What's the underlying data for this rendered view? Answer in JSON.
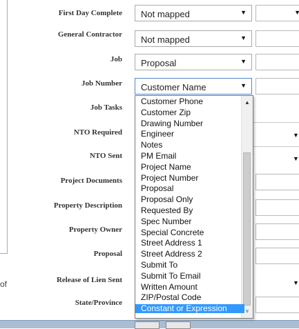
{
  "fields": [
    {
      "label": "First Day Complete",
      "value": "Not mapped"
    },
    {
      "label": "General Contractor",
      "value": "Not mapped"
    },
    {
      "label": "Job",
      "value": "Proposal"
    },
    {
      "label": "Job Number",
      "value": "Customer Name"
    },
    {
      "label": "Job Tasks"
    },
    {
      "label": "NTO Required"
    },
    {
      "label": "NTO Sent"
    },
    {
      "label": "Project Documents"
    },
    {
      "label": "Property Description"
    },
    {
      "label": "Property Owner"
    },
    {
      "label": "Proposal"
    },
    {
      "label": "Release of Lien Sent"
    },
    {
      "label": "State/Province"
    }
  ],
  "dropdown": {
    "options": [
      "Customer Phone",
      "Customer Zip",
      "Drawing Number",
      "Engineer",
      "Notes",
      "PM Email",
      "Project Name",
      "Project Number",
      "Proposal",
      "Proposal Only",
      "Requested By",
      "Spec Number",
      "Special Concrete",
      "Street Address 1",
      "Street Address 2",
      "Submit To",
      "Submit To Email",
      "Written Amount",
      "ZIP/Postal Code",
      "Constant or Expression"
    ],
    "selected_index": 19
  },
  "left_fragment": "of",
  "icons": {
    "dropdown_arrow": "▼",
    "scroll_up": "▲",
    "scroll_down": "▼"
  }
}
